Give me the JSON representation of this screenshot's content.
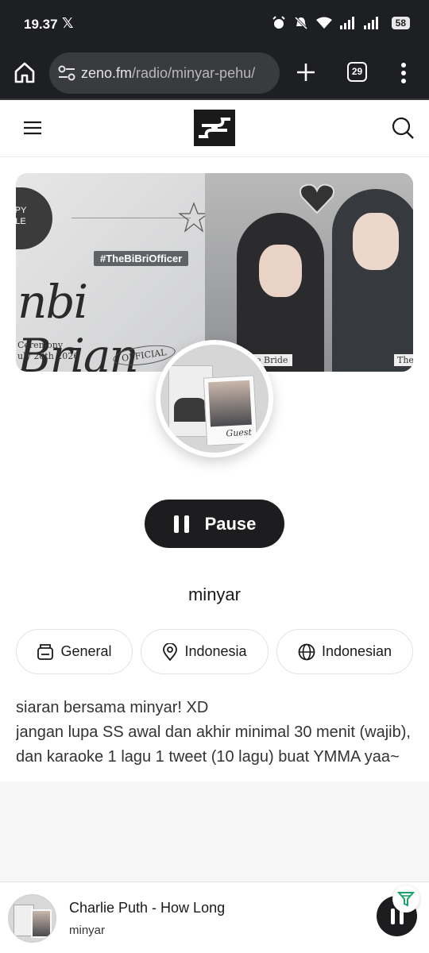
{
  "status_bar": {
    "time": "19.37",
    "app_icon": "x-logo-icon",
    "battery": "58",
    "icons": [
      "alarm-icon",
      "mute-icon",
      "wifi-icon",
      "signal-icon",
      "signal-icon"
    ]
  },
  "browser": {
    "url_host": "zeno.fm",
    "url_path": "/radio/minyar-pehu/",
    "tab_count": "29",
    "icons": [
      "home-icon",
      "site-settings-icon",
      "new-tab-icon",
      "tab-switcher-icon",
      "more-icon"
    ]
  },
  "site_header": {
    "icons": [
      "menu-icon",
      "zeno-logo-icon",
      "search-icon"
    ]
  },
  "banner": {
    "tag": "APPY\nUPLE",
    "hashtag": "#TheBiBriOfficer",
    "script_name": "nbi Brian",
    "ceremony": "Ceremony\nuly 28th 2026",
    "official": "OFFICIAL",
    "bride_tag": "e Bride",
    "the_tag": "The"
  },
  "avatar": {
    "guest_label": "Guest"
  },
  "player_controls": {
    "pause_label": "Pause"
  },
  "station": {
    "name": "minyar",
    "chips": {
      "genre": "General",
      "country": "Indonesia",
      "language": "Indonesian"
    },
    "description": "siaran bersama minyar! XD\njangan lupa SS awal dan akhir minimal 30 menit (wajib), dan karaoke 1 lagu 1 tweet (10 lagu) buat YMMA yaa~"
  },
  "mini_player": {
    "track": "Charlie Puth - How Long",
    "station": "minyar"
  },
  "colors": {
    "status_bg": "#1e1f22",
    "button_dark": "#1d1d1f",
    "url_box": "#3a3b3f"
  }
}
